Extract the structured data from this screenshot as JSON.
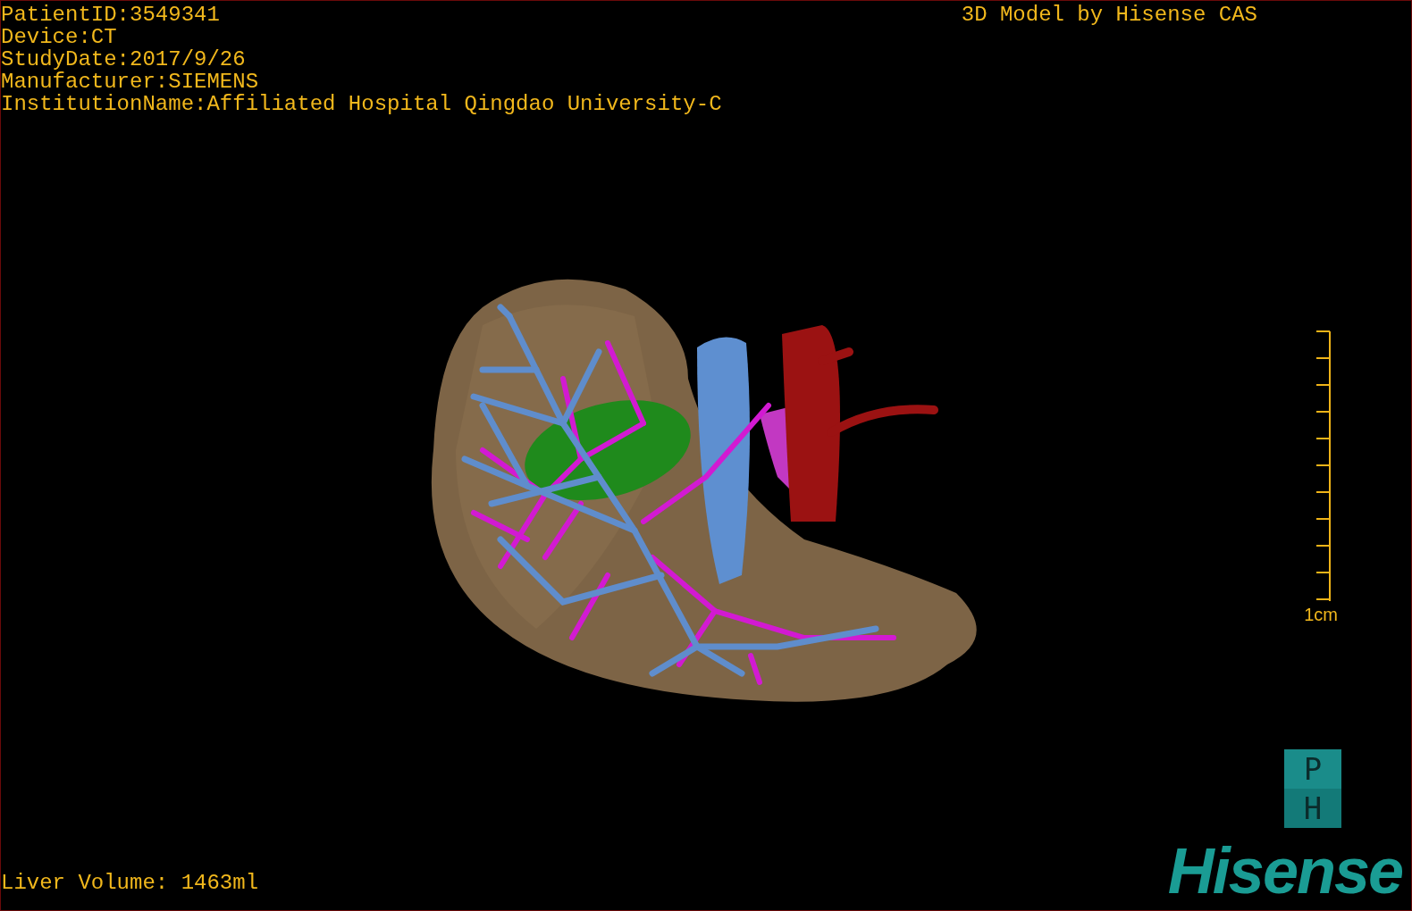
{
  "study_info": [
    "PatientID:3549341",
    "Device:CT",
    "StudyDate:2017/9/26",
    "Manufacturer:SIEMENS",
    "InstitutionName:Affiliated Hospital Qingdao University-C"
  ],
  "credit": "3D Model by Hisense CAS",
  "scale_bar": {
    "label": "1cm"
  },
  "orientation_cube": {
    "faces": [
      "P",
      "H"
    ]
  },
  "liver_volume": "Liver Volume: 1463ml",
  "logo": "Hisense"
}
